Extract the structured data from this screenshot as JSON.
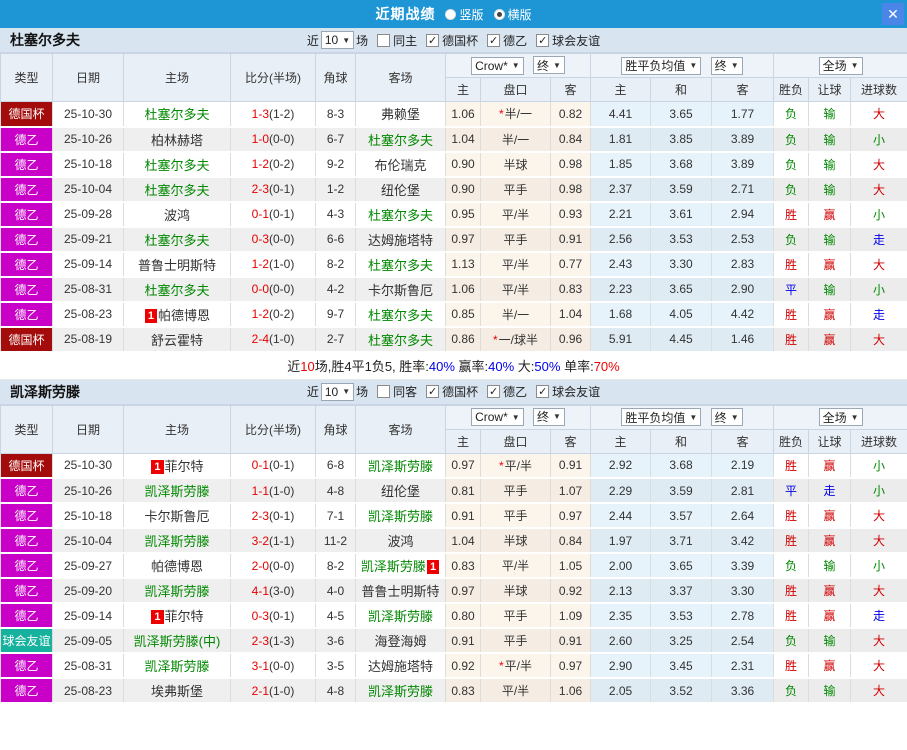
{
  "icons": {
    "dropdown": "▼",
    "close": "✕",
    "check": "✓"
  },
  "titlebar": {
    "title": "近期战绩",
    "radio_vertical_label": "竖版",
    "radio_vertical_checked": false,
    "radio_horizontal_label": "横版",
    "radio_horizontal_checked": true
  },
  "table_header": {
    "type": "类型",
    "date": "日期",
    "home": "主场",
    "score": "比分(半场)",
    "corner": "角球",
    "away": "客场",
    "odds_source_select": "Crow*",
    "odds_time_select": "终",
    "mean_select": "胜平负均值",
    "mean_time_select": "终",
    "scope_select": "全场",
    "odds_home": "主",
    "odds_hcp": "盘口",
    "odds_away": "客",
    "mean_home": "主",
    "mean_draw": "和",
    "mean_away": "客",
    "res_wl": "胜负",
    "res_hcp": "让球",
    "res_goals": "进球数"
  },
  "type_styles": {
    "德国杯": "cup",
    "德乙": "league",
    "球会友谊": "friendly"
  },
  "result_colors": {
    "胜": "red",
    "赢": "red",
    "大": "red",
    "负": "green",
    "输": "green",
    "小": "green",
    "平": "blue",
    "走": "blue"
  },
  "sections": [
    {
      "team": "杜塞尔多夫",
      "filters": {
        "recent_label": "近",
        "count": "10",
        "matches_label": "场",
        "same_label": "同主",
        "same_checked": false,
        "comps": [
          {
            "label": "德国杯",
            "checked": true
          },
          {
            "label": "德乙",
            "checked": true
          },
          {
            "label": "球会友谊",
            "checked": true
          }
        ]
      },
      "rows": [
        {
          "type": "德国杯",
          "date": "25-10-30",
          "home": "杜塞尔多夫",
          "home_green": true,
          "score_ft": "1-3",
          "score_ht": "(1-2)",
          "corner": "8-3",
          "away": "弗赖堡",
          "odds_home": "1.06",
          "hcp": "半/一",
          "hcp_star": true,
          "odds_away": "0.82",
          "mean_home": "4.41",
          "mean_draw": "3.65",
          "mean_away": "1.77",
          "res_wl": "负",
          "res_hcp": "输",
          "res_goal": "大"
        },
        {
          "type": "德乙",
          "date": "25-10-26",
          "home": "柏林赫塔",
          "score_ft": "1-0",
          "score_ht": "(0-0)",
          "corner": "6-7",
          "away": "杜塞尔多夫",
          "away_green": true,
          "odds_home": "1.04",
          "hcp": "半/一",
          "odds_away": "0.84",
          "mean_home": "1.81",
          "mean_draw": "3.85",
          "mean_away": "3.89",
          "res_wl": "负",
          "res_hcp": "输",
          "res_goal": "小"
        },
        {
          "type": "德乙",
          "date": "25-10-18",
          "home": "杜塞尔多夫",
          "home_green": true,
          "score_ft": "1-2",
          "score_ht": "(0-2)",
          "corner": "9-2",
          "away": "布伦瑞克",
          "odds_home": "0.90",
          "hcp": "半球",
          "odds_away": "0.98",
          "mean_home": "1.85",
          "mean_draw": "3.68",
          "mean_away": "3.89",
          "res_wl": "负",
          "res_hcp": "输",
          "res_goal": "大"
        },
        {
          "type": "德乙",
          "date": "25-10-04",
          "home": "杜塞尔多夫",
          "home_green": true,
          "score_ft": "2-3",
          "score_ht": "(0-1)",
          "corner": "1-2",
          "away": "纽伦堡",
          "odds_home": "0.90",
          "hcp": "平手",
          "odds_away": "0.98",
          "mean_home": "2.37",
          "mean_draw": "3.59",
          "mean_away": "2.71",
          "res_wl": "负",
          "res_hcp": "输",
          "res_goal": "大"
        },
        {
          "type": "德乙",
          "date": "25-09-28",
          "home": "波鸿",
          "score_ft": "0-1",
          "score_ht": "(0-1)",
          "corner": "4-3",
          "away": "杜塞尔多夫",
          "away_green": true,
          "odds_home": "0.95",
          "hcp": "平/半",
          "odds_away": "0.93",
          "mean_home": "2.21",
          "mean_draw": "3.61",
          "mean_away": "2.94",
          "res_wl": "胜",
          "res_hcp": "赢",
          "res_goal": "小"
        },
        {
          "type": "德乙",
          "date": "25-09-21",
          "home": "杜塞尔多夫",
          "home_green": true,
          "score_ft": "0-3",
          "score_ht": "(0-0)",
          "corner": "6-6",
          "away": "达姆施塔特",
          "odds_home": "0.97",
          "hcp": "平手",
          "odds_away": "0.91",
          "mean_home": "2.56",
          "mean_draw": "3.53",
          "mean_away": "2.53",
          "res_wl": "负",
          "res_hcp": "输",
          "res_goal": "走"
        },
        {
          "type": "德乙",
          "date": "25-09-14",
          "home": "普鲁士明斯特",
          "score_ft": "1-2",
          "score_ht": "(1-0)",
          "corner": "8-2",
          "away": "杜塞尔多夫",
          "away_green": true,
          "odds_home": "1.13",
          "hcp": "平/半",
          "odds_away": "0.77",
          "mean_home": "2.43",
          "mean_draw": "3.30",
          "mean_away": "2.83",
          "res_wl": "胜",
          "res_hcp": "赢",
          "res_goal": "大"
        },
        {
          "type": "德乙",
          "date": "25-08-31",
          "home": "杜塞尔多夫",
          "home_green": true,
          "score_ft": "0-0",
          "score_ht": "(0-0)",
          "corner": "4-2",
          "away": "卡尔斯鲁厄",
          "odds_home": "1.06",
          "hcp": "平/半",
          "odds_away": "0.83",
          "mean_home": "2.23",
          "mean_draw": "3.65",
          "mean_away": "2.90",
          "res_wl": "平",
          "res_hcp": "输",
          "res_goal": "小"
        },
        {
          "type": "德乙",
          "date": "25-08-23",
          "home": "帕德博恩",
          "home_badge": "1",
          "home_badge_pos": "before",
          "score_ft": "1-2",
          "score_ht": "(0-2)",
          "corner": "9-7",
          "away": "杜塞尔多夫",
          "away_green": true,
          "odds_home": "0.85",
          "hcp": "半/一",
          "odds_away": "1.04",
          "mean_home": "1.68",
          "mean_draw": "4.05",
          "mean_away": "4.42",
          "res_wl": "胜",
          "res_hcp": "赢",
          "res_goal": "走"
        },
        {
          "type": "德国杯",
          "date": "25-08-19",
          "home": "舒云霍特",
          "score_ft": "2-4",
          "score_ht": "(1-0)",
          "corner": "2-7",
          "away": "杜塞尔多夫",
          "away_green": true,
          "odds_home": "0.86",
          "hcp": "一/球半",
          "hcp_star": true,
          "odds_away": "0.96",
          "mean_home": "5.91",
          "mean_draw": "4.45",
          "mean_away": "1.46",
          "res_wl": "胜",
          "res_hcp": "赢",
          "res_goal": "大"
        }
      ],
      "summary_parts": [
        {
          "t": "近",
          "c": "k"
        },
        {
          "t": "10",
          "c": "r"
        },
        {
          "t": "场,胜4平1负5, 胜率:",
          "c": "k"
        },
        {
          "t": "40%",
          "c": "b"
        },
        {
          "t": " 赢率:",
          "c": "k"
        },
        {
          "t": "40%",
          "c": "b"
        },
        {
          "t": " 大:",
          "c": "k"
        },
        {
          "t": "50%",
          "c": "b"
        },
        {
          "t": " 单率:",
          "c": "k"
        },
        {
          "t": "70%",
          "c": "r"
        }
      ]
    },
    {
      "team": "凯泽斯劳滕",
      "filters": {
        "recent_label": "近",
        "count": "10",
        "matches_label": "场",
        "same_label": "同客",
        "same_checked": false,
        "comps": [
          {
            "label": "德国杯",
            "checked": true
          },
          {
            "label": "德乙",
            "checked": true
          },
          {
            "label": "球会友谊",
            "checked": true
          }
        ]
      },
      "rows": [
        {
          "type": "德国杯",
          "date": "25-10-30",
          "home": "菲尔特",
          "home_badge": "1",
          "home_badge_pos": "before",
          "score_ft": "0-1",
          "score_ht": "(0-1)",
          "corner": "6-8",
          "away": "凯泽斯劳滕",
          "away_green": true,
          "odds_home": "0.97",
          "hcp": "平/半",
          "hcp_star": true,
          "odds_away": "0.91",
          "mean_home": "2.92",
          "mean_draw": "3.68",
          "mean_away": "2.19",
          "res_wl": "胜",
          "res_hcp": "赢",
          "res_goal": "小"
        },
        {
          "type": "德乙",
          "date": "25-10-26",
          "home": "凯泽斯劳滕",
          "home_green": true,
          "score_ft": "1-1",
          "score_ht": "(1-0)",
          "corner": "4-8",
          "away": "纽伦堡",
          "odds_home": "0.81",
          "hcp": "平手",
          "odds_away": "1.07",
          "mean_home": "2.29",
          "mean_draw": "3.59",
          "mean_away": "2.81",
          "res_wl": "平",
          "res_hcp": "走",
          "res_goal": "小"
        },
        {
          "type": "德乙",
          "date": "25-10-18",
          "home": "卡尔斯鲁厄",
          "score_ft": "2-3",
          "score_ht": "(0-1)",
          "corner": "7-1",
          "away": "凯泽斯劳滕",
          "away_green": true,
          "odds_home": "0.91",
          "hcp": "平手",
          "odds_away": "0.97",
          "mean_home": "2.44",
          "mean_draw": "3.57",
          "mean_away": "2.64",
          "res_wl": "胜",
          "res_hcp": "赢",
          "res_goal": "大"
        },
        {
          "type": "德乙",
          "date": "25-10-04",
          "home": "凯泽斯劳滕",
          "home_green": true,
          "score_ft": "3-2",
          "score_ht": "(1-1)",
          "corner": "11-2",
          "away": "波鸿",
          "odds_home": "1.04",
          "hcp": "半球",
          "odds_away": "0.84",
          "mean_home": "1.97",
          "mean_draw": "3.71",
          "mean_away": "3.42",
          "res_wl": "胜",
          "res_hcp": "赢",
          "res_goal": "大"
        },
        {
          "type": "德乙",
          "date": "25-09-27",
          "home": "帕德博恩",
          "score_ft": "2-0",
          "score_ht": "(0-0)",
          "corner": "8-2",
          "away": "凯泽斯劳滕",
          "away_green": true,
          "away_badge": "1",
          "away_badge_pos": "after",
          "odds_home": "0.83",
          "hcp": "平/半",
          "odds_away": "1.05",
          "mean_home": "2.00",
          "mean_draw": "3.65",
          "mean_away": "3.39",
          "res_wl": "负",
          "res_hcp": "输",
          "res_goal": "小"
        },
        {
          "type": "德乙",
          "date": "25-09-20",
          "home": "凯泽斯劳滕",
          "home_green": true,
          "score_ft": "4-1",
          "score_ht": "(3-0)",
          "corner": "4-0",
          "away": "普鲁士明斯特",
          "odds_home": "0.97",
          "hcp": "半球",
          "odds_away": "0.92",
          "mean_home": "2.13",
          "mean_draw": "3.37",
          "mean_away": "3.30",
          "res_wl": "胜",
          "res_hcp": "赢",
          "res_goal": "大"
        },
        {
          "type": "德乙",
          "date": "25-09-14",
          "home": "菲尔特",
          "home_badge": "1",
          "home_badge_pos": "before",
          "score_ft": "0-3",
          "score_ht": "(0-1)",
          "corner": "4-5",
          "away": "凯泽斯劳滕",
          "away_green": true,
          "odds_home": "0.80",
          "hcp": "平手",
          "odds_away": "1.09",
          "mean_home": "2.35",
          "mean_draw": "3.53",
          "mean_away": "2.78",
          "res_wl": "胜",
          "res_hcp": "赢",
          "res_goal": "走"
        },
        {
          "type": "球会友谊",
          "date": "25-09-05",
          "home": "凯泽斯劳滕(中)",
          "home_green": true,
          "score_ft": "2-3",
          "score_ht": "(1-3)",
          "corner": "3-6",
          "away": "海登海姆",
          "odds_home": "0.91",
          "hcp": "平手",
          "odds_away": "0.91",
          "mean_home": "2.60",
          "mean_draw": "3.25",
          "mean_away": "2.54",
          "res_wl": "负",
          "res_hcp": "输",
          "res_goal": "大"
        },
        {
          "type": "德乙",
          "date": "25-08-31",
          "home": "凯泽斯劳滕",
          "home_green": true,
          "score_ft": "3-1",
          "score_ht": "(0-0)",
          "corner": "3-5",
          "away": "达姆施塔特",
          "odds_home": "0.92",
          "hcp": "平/半",
          "hcp_star": true,
          "odds_away": "0.97",
          "mean_home": "2.90",
          "mean_draw": "3.45",
          "mean_away": "2.31",
          "res_wl": "胜",
          "res_hcp": "赢",
          "res_goal": "大"
        },
        {
          "type": "德乙",
          "date": "25-08-23",
          "home": "埃弗斯堡",
          "score_ft": "2-1",
          "score_ht": "(1-0)",
          "corner": "4-8",
          "away": "凯泽斯劳滕",
          "away_green": true,
          "odds_home": "0.83",
          "hcp": "平/半",
          "odds_away": "1.06",
          "mean_home": "2.05",
          "mean_draw": "3.52",
          "mean_away": "3.36",
          "res_wl": "负",
          "res_hcp": "输",
          "res_goal": "大"
        }
      ]
    }
  ]
}
